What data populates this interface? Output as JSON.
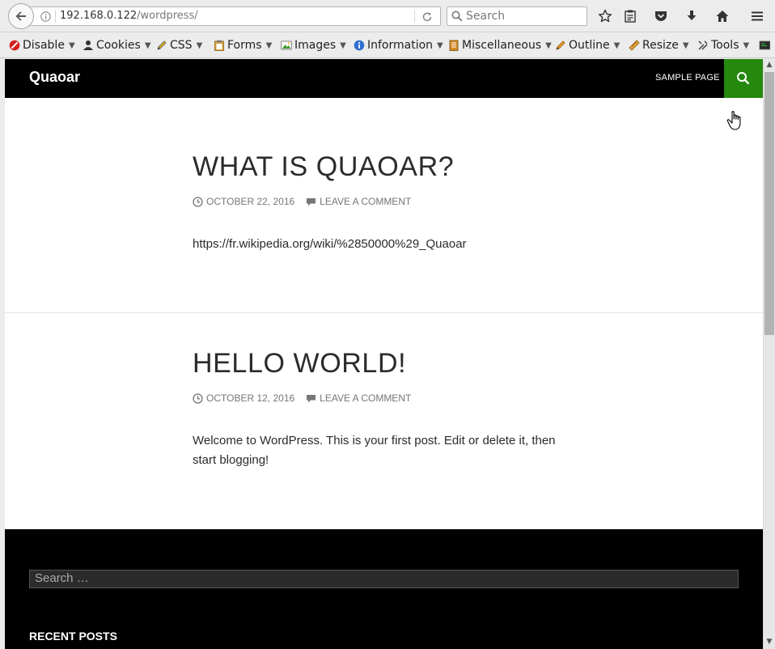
{
  "browser": {
    "url_host": "192.168.0.122",
    "url_path": "/wordpress/",
    "search_placeholder": "Search"
  },
  "devbar": {
    "items": [
      {
        "label": "Disable"
      },
      {
        "label": "Cookies"
      },
      {
        "label": "CSS"
      },
      {
        "label": "Forms"
      },
      {
        "label": "Images"
      },
      {
        "label": "Information"
      },
      {
        "label": "Miscellaneous"
      },
      {
        "label": "Outline"
      },
      {
        "label": "Resize"
      },
      {
        "label": "Tools"
      }
    ]
  },
  "site": {
    "title": "Quaoar",
    "nav_sample_page": "SAMPLE PAGE",
    "accent": "#24890d"
  },
  "posts": [
    {
      "title": "WHAT IS QUAOAR?",
      "date": "OCTOBER 22, 2016",
      "comment": "LEAVE A COMMENT",
      "content": "https://fr.wikipedia.org/wiki/%2850000%29_Quaoar"
    },
    {
      "title": "HELLO WORLD!",
      "date": "OCTOBER 12, 2016",
      "comment": "LEAVE A COMMENT",
      "content": "Welcome to WordPress. This is your first post. Edit or delete it, then start blogging!"
    }
  ],
  "footer": {
    "search_placeholder": "Search …",
    "recent_posts_heading": "RECENT POSTS"
  }
}
